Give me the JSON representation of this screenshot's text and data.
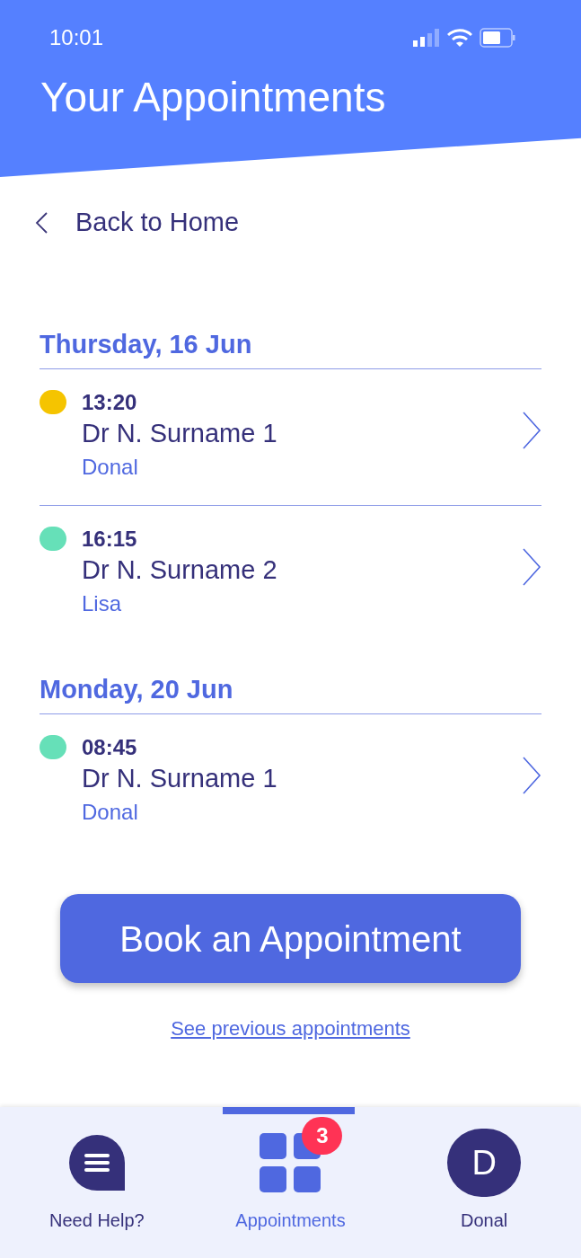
{
  "status_bar": {
    "time": "10:01"
  },
  "title": "Your Appointments",
  "back": {
    "label": "Back to Home"
  },
  "groups": [
    {
      "date": "Thursday, 16 Jun",
      "appointments": [
        {
          "time": "13:20",
          "doctor": "Dr N. Surname 1",
          "patient": "Donal",
          "color": "#f5c400"
        },
        {
          "time": "16:15",
          "doctor": "Dr N. Surname 2",
          "patient": "Lisa",
          "color": "#66e0b8"
        }
      ]
    },
    {
      "date": "Monday, 20 Jun",
      "appointments": [
        {
          "time": "08:45",
          "doctor": "Dr N. Surname 1",
          "patient": "Donal",
          "color": "#66e0b8"
        }
      ]
    }
  ],
  "book_button": {
    "label": "Book an Appointment"
  },
  "previous_link": {
    "label": "See previous appointments"
  },
  "nav": [
    {
      "kind": "help",
      "label": "Need Help?",
      "selected": false
    },
    {
      "kind": "grid",
      "label": "Appointments",
      "selected": true,
      "badge": "3"
    },
    {
      "kind": "avatar",
      "label": "Donal",
      "selected": false,
      "initial": "D"
    }
  ]
}
